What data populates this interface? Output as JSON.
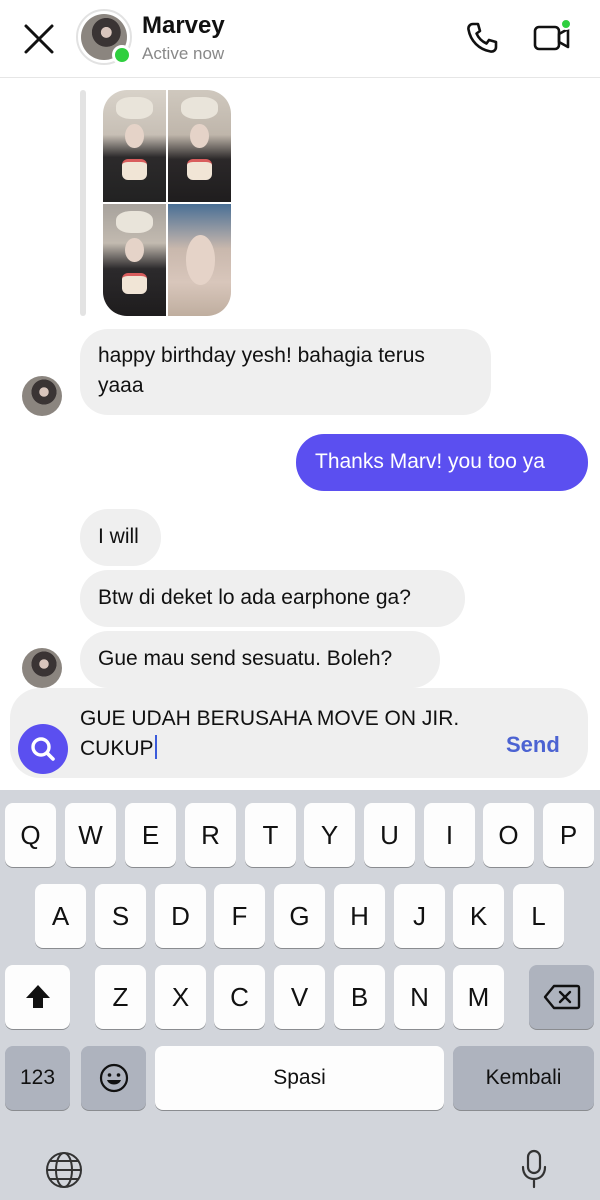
{
  "header": {
    "contact_name": "Marvey",
    "status": "Active now"
  },
  "colors": {
    "accent": "#5b4ff0",
    "send": "#4c63d2",
    "online": "#2fcf3f",
    "bubble_incoming": "#efefef",
    "keyboard_bg": "#d2d5db"
  },
  "messages": [
    {
      "from": "contact",
      "text": "happy birthday yesh! bahagia terus yaaa"
    },
    {
      "from": "me",
      "text": "Thanks Marv! you too ya"
    },
    {
      "from": "contact",
      "text": "I will"
    },
    {
      "from": "contact",
      "text": "Btw di deket lo ada earphone ga?"
    },
    {
      "from": "contact",
      "text": "Gue mau send sesuatu. Boleh?"
    }
  ],
  "composer": {
    "value": "GUE UDAH BERUSAHA MOVE ON JIR. CUKUP",
    "send_label": "Send"
  },
  "keyboard": {
    "row1": [
      "Q",
      "W",
      "E",
      "R",
      "T",
      "Y",
      "U",
      "I",
      "O",
      "P"
    ],
    "row2": [
      "A",
      "S",
      "D",
      "F",
      "G",
      "H",
      "J",
      "K",
      "L"
    ],
    "row3": [
      "Z",
      "X",
      "C",
      "V",
      "B",
      "N",
      "M"
    ],
    "numbers_label": "123",
    "space_label": "Spasi",
    "return_label": "Kembali"
  },
  "icons": {
    "close": "close-icon",
    "call": "phone-icon",
    "video": "video-camera-icon",
    "search": "search-icon",
    "shift": "shift-icon",
    "delete": "backspace-icon",
    "emoji": "emoji-icon",
    "globe": "globe-icon",
    "mic": "microphone-icon"
  }
}
